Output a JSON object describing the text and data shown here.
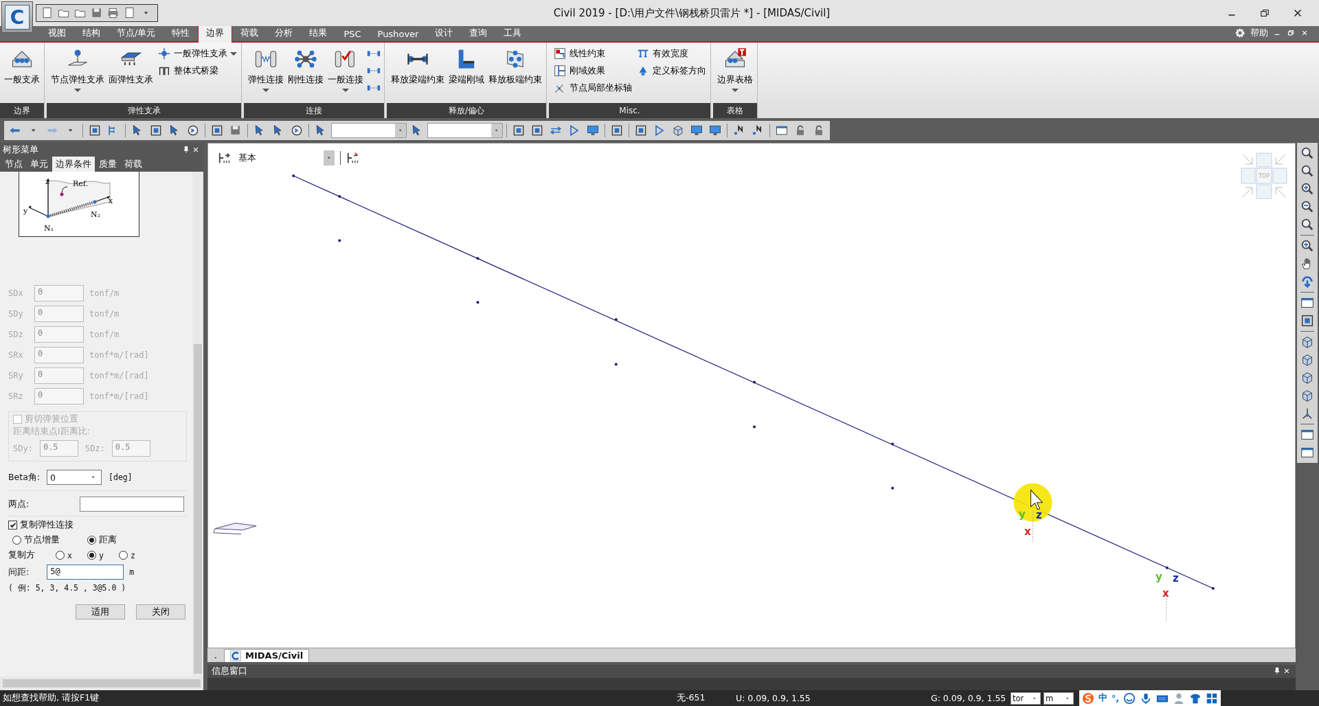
{
  "window": {
    "logo": "C",
    "title": "Civil 2019 - [D:\\用户文件\\钢栈桥贝雷片 *] - [MIDAS/Civil]",
    "help": "帮助"
  },
  "ribbon_tabs": [
    {
      "label": "视图",
      "selected": false
    },
    {
      "label": "结构",
      "selected": false
    },
    {
      "label": "节点/单元",
      "selected": false
    },
    {
      "label": "特性",
      "selected": false
    },
    {
      "label": "边界",
      "selected": true
    },
    {
      "label": "荷载",
      "selected": false
    },
    {
      "label": "分析",
      "selected": false
    },
    {
      "label": "结果",
      "selected": false
    },
    {
      "label": "PSC",
      "selected": false
    },
    {
      "label": "Pushover",
      "selected": false
    },
    {
      "label": "设计",
      "selected": false
    },
    {
      "label": "查询",
      "selected": false
    },
    {
      "label": "工具",
      "selected": false
    }
  ],
  "ribbon_groups": [
    {
      "label": "边界",
      "items": [
        {
          "kind": "large",
          "label": "一般支承",
          "dropdown": false
        }
      ]
    },
    {
      "label": "弹性支承",
      "items": [
        {
          "kind": "large",
          "label": "节点弹性支承",
          "dropdown": true
        },
        {
          "kind": "large",
          "label": "面弹性支承",
          "dropdown": false
        },
        {
          "kind": "small",
          "label": "一般弹性支承",
          "dropdown": true
        },
        {
          "kind": "small",
          "label": "整体式桥梁",
          "dropdown": false
        }
      ]
    },
    {
      "label": "连接",
      "items": [
        {
          "kind": "large",
          "label": "弹性连接",
          "dropdown": true
        },
        {
          "kind": "large",
          "label": "刚性连接",
          "dropdown": false
        },
        {
          "kind": "large",
          "label": "一般连接",
          "dropdown": true
        },
        {
          "kind": "icon"
        },
        {
          "kind": "icon"
        },
        {
          "kind": "icon"
        }
      ]
    },
    {
      "label": "释放/偏心",
      "items": [
        {
          "kind": "large",
          "label": "释放梁端约束",
          "dropdown": false
        },
        {
          "kind": "large",
          "label": "梁端刚域",
          "dropdown": false
        },
        {
          "kind": "large",
          "label": "释放板端约束",
          "dropdown": false
        }
      ]
    },
    {
      "label": "Misc.",
      "items": [
        {
          "kind": "small",
          "label": "线性约束",
          "dropdown": false
        },
        {
          "kind": "small",
          "label": "刚域效果",
          "dropdown": false
        },
        {
          "kind": "small",
          "label": "节点局部坐标轴",
          "dropdown": false
        },
        {
          "kind": "small",
          "label": "有效宽度",
          "dropdown": false
        },
        {
          "kind": "small",
          "label": "定义标签方向",
          "dropdown": false
        }
      ]
    },
    {
      "label": "表格",
      "items": [
        {
          "kind": "large",
          "label": "边界表格",
          "dropdown": true
        }
      ]
    }
  ],
  "left_panel": {
    "title": "树形菜单",
    "tabs": [
      {
        "label": "节点",
        "selected": false
      },
      {
        "label": "单元",
        "selected": false
      },
      {
        "label": "边界条件",
        "selected": true
      },
      {
        "label": "质量",
        "selected": false
      },
      {
        "label": "荷载",
        "selected": false
      }
    ],
    "diagram": {
      "labels": [
        "z",
        "Ref.",
        "x",
        "y",
        "N₁",
        "N₂"
      ]
    },
    "springs": [
      {
        "label": "SDx",
        "value": "0",
        "unit": "tonf/m",
        "disabled": true
      },
      {
        "label": "SDy",
        "value": "0",
        "unit": "tonf/m",
        "disabled": true
      },
      {
        "label": "SDz",
        "value": "0",
        "unit": "tonf/m",
        "disabled": true
      },
      {
        "label": "SRx",
        "value": "0",
        "unit": "tonf*m/[rad]",
        "disabled": true
      },
      {
        "label": "SRy",
        "value": "0",
        "unit": "tonf*m/[rad]",
        "disabled": true
      },
      {
        "label": "SRz",
        "value": "0",
        "unit": "tonf*m/[rad]",
        "disabled": true
      }
    ],
    "shear_spring": {
      "label": "剪切弹簧位置",
      "checked": false,
      "disabled": true,
      "ratio_label": "距离结束点I距离比:",
      "fields": [
        {
          "label": "SDy:",
          "value": "0.5"
        },
        {
          "label": "SDz:",
          "value": "0.5"
        }
      ]
    },
    "beta": {
      "label": "Beta角:",
      "value": "0",
      "unit": "[deg]"
    },
    "two_points": {
      "label": "两点:"
    },
    "copy": {
      "label": "复制弹性连接",
      "checked": true,
      "modes": [
        {
          "label": "节点增量",
          "selected": false
        },
        {
          "label": "距离",
          "selected": true
        }
      ],
      "direction_label": "复制方",
      "directions": [
        {
          "label": "x",
          "selected": false
        },
        {
          "label": "y",
          "selected": true
        },
        {
          "label": "z",
          "selected": false
        }
      ],
      "spacing_label": "间距:",
      "spacing_value": "5@",
      "spacing_unit": "m",
      "example": "( 例: 5, 3, 4.5 , 3@5.0 )"
    },
    "buttons": [
      "适用",
      "关闭"
    ]
  },
  "canvas": {
    "view_label": "基本",
    "view_cube_label": "TOP",
    "triads": [
      {
        "labels": [
          "y",
          "z",
          "x"
        ]
      },
      {
        "labels": [
          "y",
          "z",
          "x"
        ]
      }
    ]
  },
  "document_tabs": [
    {
      "label": "MIDAS/Civil"
    }
  ],
  "info_window": {
    "title": "信息窗口"
  },
  "status_bar": {
    "help": "如想查找帮助, 请按F1键",
    "node": "无-651",
    "u": "U: 0.09, 0.9, 1.55",
    "g": "G: 0.09, 0.9, 1.55",
    "force_unit": "tor",
    "length_unit": "m",
    "ime": [
      "中",
      "°,"
    ]
  }
}
